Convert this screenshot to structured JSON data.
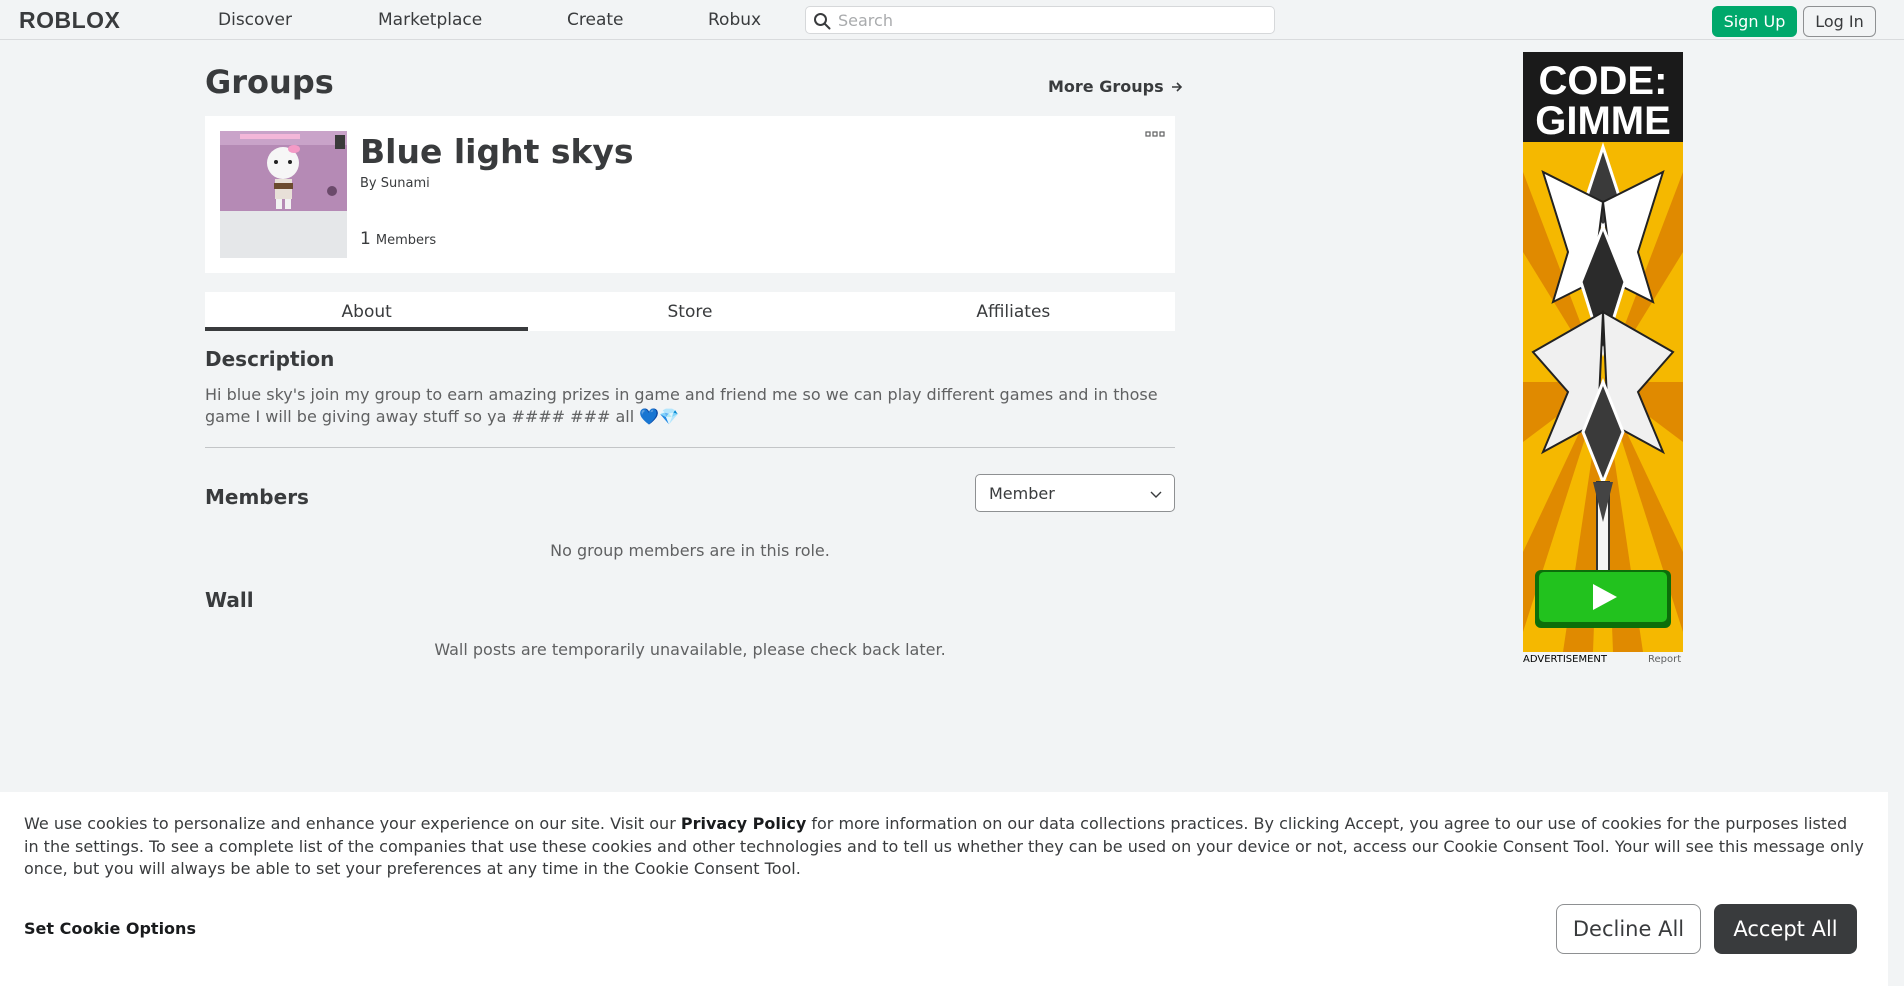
{
  "brand": {
    "logo_text": "ROBLOX"
  },
  "nav": {
    "links": [
      "Discover",
      "Marketplace",
      "Create",
      "Robux"
    ],
    "search_placeholder": "Search",
    "signup_label": "Sign Up",
    "login_label": "Log In"
  },
  "page": {
    "title": "Groups",
    "more_groups": "More Groups"
  },
  "group": {
    "name": "Blue light skys",
    "owner_prefix": "By",
    "owner": "Sunami",
    "member_count": "1",
    "members_label": "Members"
  },
  "tabs": [
    {
      "label": "About",
      "active": true
    },
    {
      "label": "Store",
      "active": false
    },
    {
      "label": "Affiliates",
      "active": false
    }
  ],
  "about": {
    "description_heading": "Description",
    "description": "Hi blue sky's join my group to earn amazing prizes in game and friend me so we can play different games and in those game I will be giving away stuff so ya #### ### all 💙💎",
    "members_heading": "Members",
    "role_selected": "Member",
    "members_empty": "No group members are in this role.",
    "wall_heading": "Wall",
    "wall_empty": "Wall posts are temporarily unavailable, please check back later."
  },
  "ad": {
    "headline_line1": "CODE:",
    "headline_line2": "GIMME",
    "label": "ADVERTISEMENT",
    "report": "Report"
  },
  "cookie": {
    "text_before": "We use cookies to personalize and enhance your experience on our site. Visit our ",
    "privacy_link": "Privacy Policy",
    "text_after": " for more information on our data collections practices. By clicking Accept, you agree to our use of cookies for the purposes listed in the settings. To see a complete list of the companies that use these cookies and other technologies and to tell us whether they can be used on your device or not, access our Cookie Consent Tool. Your will see this message only once, but you will always be able to set your preferences at any time in the Cookie Consent Tool.",
    "set_options": "Set Cookie Options",
    "decline": "Decline All",
    "accept": "Accept All"
  },
  "colors": {
    "signup_green": "#00a86b",
    "ad_yellow": "#f5b800",
    "ad_play_green": "#22c21e"
  }
}
